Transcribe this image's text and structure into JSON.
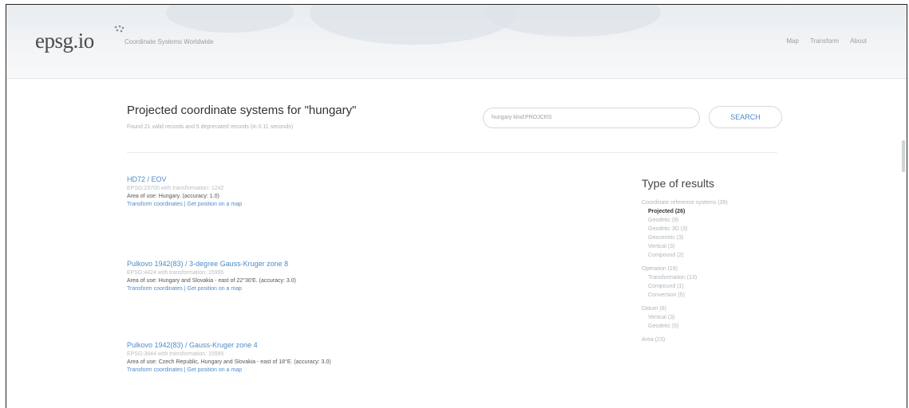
{
  "header": {
    "logo": "epsg.io",
    "tagline": "Coordinate Systems Worldwide",
    "nav": [
      "Map",
      "Transform",
      "About"
    ]
  },
  "search": {
    "heading": "Projected coordinate systems for \"hungary\"",
    "found": "Found 21 valid records and 5 deprecated records (in 0.11 seconds)",
    "input_value": "hungary kind:PROJCRS",
    "button_label": "SEARCH"
  },
  "results": [
    {
      "title": "HD72 / EOV",
      "code": "EPSG:23700 with transformation: 1242",
      "area": "Area of use: Hungary. (accuracy: 1.0)",
      "link_transform": "Transform coordinates",
      "separator": "|",
      "link_map": "Get position on a map"
    },
    {
      "title": "Pulkovo 1942(83) / 3-degree Gauss-Kruger zone 8",
      "code": "EPSG:4424 with transformation: 15995",
      "area": "Area of use: Hungary and Slovakia - east of 22°30'E. (accuracy: 3.0)",
      "link_transform": "Transform coordinates",
      "separator": "|",
      "link_map": "Get position on a map"
    },
    {
      "title": "Pulkovo 1942(83) / Gauss-Kruger zone 4",
      "code": "EPSG:3844 with transformation: 15995",
      "area": "Area of use: Czech Republic, Hungary and Slovakia - east of 18°E. (accuracy: 3.0)",
      "link_transform": "Transform coordinates",
      "separator": "|",
      "link_map": "Get position on a map"
    }
  ],
  "sidebar": {
    "title": "Type of results",
    "groups": [
      {
        "label": "Coordinate reference systems (39)",
        "items": [
          "Projected (26)",
          "Geodetic (9)",
          "Geodetic 3D (3)",
          "Geocentric (3)",
          "Vertical (3)",
          "Compound (2)"
        ]
      },
      {
        "label": "Operation (19)",
        "items": [
          "Transformation (13)",
          "Compound (1)",
          "Conversion (5)"
        ]
      },
      {
        "label": "Datum (8)",
        "items": [
          "Vertical (3)",
          "Geodetic (5)"
        ]
      },
      {
        "label": "Area (23)",
        "items": []
      }
    ]
  },
  "colors": {
    "link": "#4f8bc9",
    "muted": "#b0b6bb",
    "text": "#333333"
  }
}
